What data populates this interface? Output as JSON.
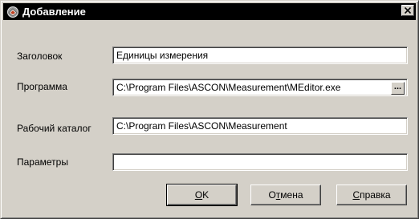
{
  "window": {
    "title": "Добавление",
    "icon": "app-icon",
    "close_icon": "close-icon"
  },
  "form": {
    "title_label": "Заголовок",
    "title_value": "Единицы измерения",
    "program_label": "Программа",
    "program_value": "C:\\Program Files\\ASCON\\Measurement\\MEditor.exe",
    "browse_label": "...",
    "workdir_label": "Рабочий каталог",
    "workdir_value": "C:\\Program Files\\ASCON\\Measurement",
    "params_label": "Параметры",
    "params_value": ""
  },
  "buttons": {
    "ok_accel": "O",
    "ok_rest": "K",
    "cancel_pre": "О",
    "cancel_accel": "т",
    "cancel_rest": "мена",
    "help_accel": "С",
    "help_rest": "правка"
  }
}
